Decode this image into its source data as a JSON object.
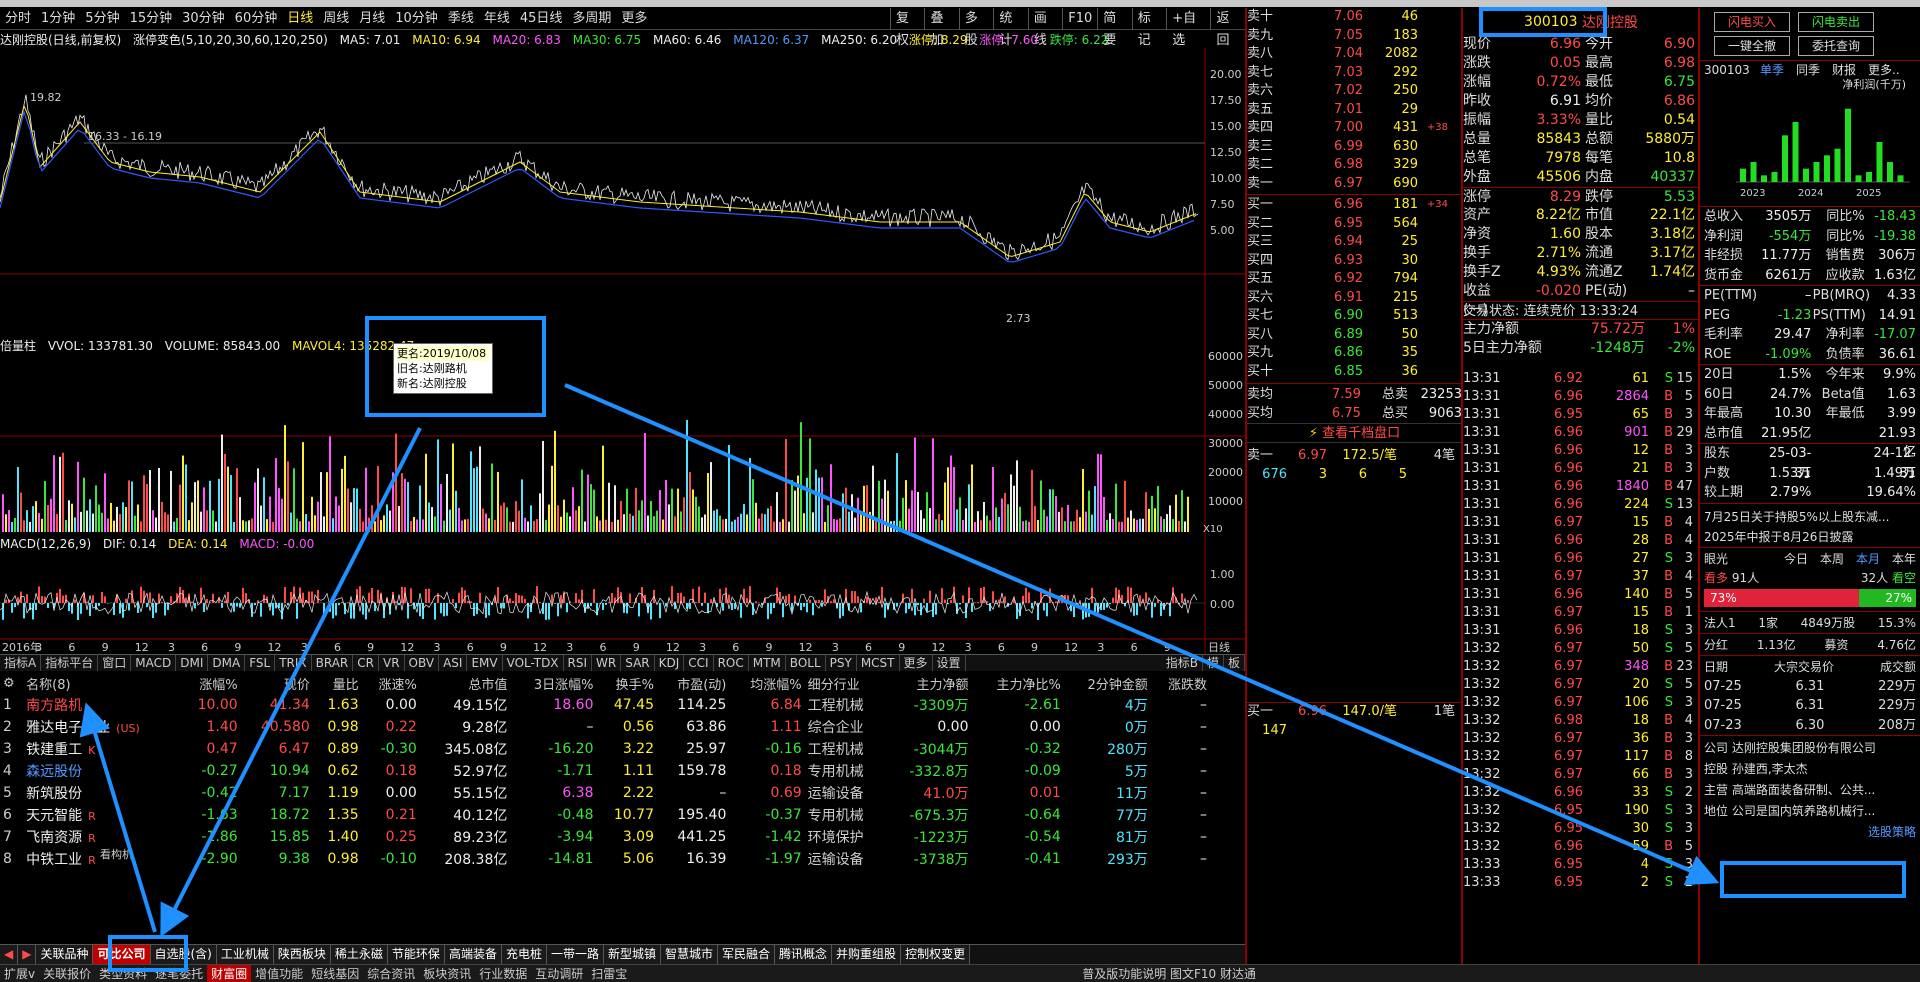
{
  "period_bar": {
    "items": [
      "分时",
      "1分钟",
      "5分钟",
      "15分钟",
      "30分钟",
      "60分钟",
      "日线",
      "周线",
      "月线",
      "10分钟",
      "季线",
      "年线",
      "45日线",
      "多周期",
      "更多"
    ],
    "active": "日线"
  },
  "toolbar": {
    "items": [
      "复权",
      "叠加",
      "多股",
      "统计",
      "画线",
      "F10",
      "简要",
      "标记",
      "+自选",
      "返回"
    ]
  },
  "chart_info": {
    "name": "达刚控股(日线,前复权)",
    "indicator": "涨停变色(5,10,20,30,60,120,250)",
    "ma5": "MA5: 7.01",
    "ma10": "MA10: 6.94",
    "ma20": "MA20: 6.83",
    "ma30": "MA30: 6.75",
    "ma60": "MA60: 6.46",
    "ma120": "MA120: 6.37",
    "ma250": "MA250: 6.20",
    "zt": "涨停: 8.29",
    "zd": "涨停: 7.60",
    "dt": "跌停: 6.22"
  },
  "price_axis": [
    "20.00",
    "17.50",
    "15.00",
    "12.50",
    "10.00",
    "7.50",
    "5.00"
  ],
  "price_marks": {
    "high": "19.82",
    "mid": "16.33 - 16.19",
    "low": "2.73"
  },
  "volume_info": {
    "name": "倍量柱",
    "vvol": "VVOL: 133781.30",
    "volume": "VOLUME: 85843.00",
    "mavol": "MAVOL4: 135282.47"
  },
  "volume_axis": [
    "60000",
    "50000",
    "40000",
    "30000",
    "20000",
    "10000"
  ],
  "volume_unit": "X10",
  "tooltip": {
    "line1": "更名:2019/10/08",
    "line2": "旧名:达刚路机",
    "line3": "新名:达刚控股"
  },
  "macd_info": {
    "name": "MACD(12,26,9)",
    "dif": "DIF: 0.14",
    "dea": "DEA: 0.14",
    "macd": "MACD: -0.00"
  },
  "macd_axis": [
    "1.00",
    "0.00"
  ],
  "time_axis": [
    "2016年",
    "3",
    "6",
    "9",
    "12",
    "3",
    "6",
    "9",
    "12",
    "3",
    "6",
    "9",
    "12",
    "3",
    "6",
    "9",
    "12",
    "3",
    "6",
    "9",
    "12",
    "3",
    "6",
    "9",
    "12",
    "3",
    "6",
    "9",
    "12",
    "3",
    "6",
    "9",
    "12",
    "3",
    "6",
    "9",
    "日线"
  ],
  "indicator_tabs": [
    "指标A",
    "指标平台",
    "窗口",
    "MACD",
    "DMI",
    "DMA",
    "FSL",
    "TRIX",
    "BRAR",
    "CR",
    "VR",
    "OBV",
    "ASI",
    "EMV",
    "VOL-TDX",
    "RSI",
    "WR",
    "SAR",
    "KDJ",
    "CCI",
    "ROC",
    "MTM",
    "BOLL",
    "PSY",
    "MCST",
    "更多",
    "设置"
  ],
  "indicator_right": [
    "指标B",
    "模",
    "板"
  ],
  "stock_table": {
    "headers": [
      "名称(8)",
      "涨幅%",
      "现价",
      "量比",
      "涨速%",
      "总市值",
      "3日涨幅%",
      "换手%",
      "市盈(动)",
      "均涨幅%",
      "细分行业",
      "主力净额",
      "主力净比%",
      "2分钟金额",
      "涨跌数"
    ],
    "rows": [
      [
        "1",
        "南方路机",
        "",
        "10.00",
        "41.34",
        "1.63",
        "0.00",
        "49.15亿",
        "18.60",
        "47.45",
        "114.25",
        "6.84",
        "工程机械",
        "-3309万",
        "-2.61",
        "4万",
        "–"
      ],
      [
        "2",
        "雅达电子工业",
        "(US)",
        "1.40",
        "40.580",
        "0.98",
        "0.22",
        "9.28亿",
        "–",
        "0.56",
        "63.86",
        "1.11",
        "综合企业",
        "0.00",
        "0.00",
        "0万",
        "–"
      ],
      [
        "3",
        "铁建重工",
        "K",
        "0.47",
        "6.47",
        "0.89",
        "-0.30",
        "345.08亿",
        "-16.20",
        "3.22",
        "25.97",
        "-0.16",
        "工程机械",
        "-3044万",
        "-0.32",
        "280万",
        "–"
      ],
      [
        "4",
        "森远股份",
        "",
        "-0.27",
        "10.94",
        "0.62",
        "0.18",
        "52.97亿",
        "-1.71",
        "1.11",
        "159.78",
        "0.18",
        "专用机械",
        "-332.8万",
        "-0.09",
        "5万",
        "–"
      ],
      [
        "5",
        "新筑股份",
        "",
        "-0.42",
        "7.17",
        "1.19",
        "0.00",
        "55.15亿",
        "6.38",
        "2.22",
        "–",
        "0.69",
        "运输设备",
        "41.0万",
        "0.01",
        "11万",
        "–"
      ],
      [
        "6",
        "天元智能",
        "R",
        "-1.63",
        "18.72",
        "1.35",
        "0.21",
        "40.12亿",
        "-0.48",
        "10.77",
        "195.40",
        "-0.37",
        "专用机械",
        "-675.3万",
        "-0.64",
        "77万",
        "–"
      ],
      [
        "7",
        "飞南资源",
        "R",
        "-1.86",
        "15.85",
        "1.40",
        "0.25",
        "89.23亿",
        "-3.94",
        "3.09",
        "441.25",
        "-1.42",
        "环境保护",
        "-1223万",
        "-0.54",
        "81万",
        "–"
      ],
      [
        "8",
        "中铁工业",
        "R",
        "-2.90",
        "9.38",
        "0.98",
        "-0.10",
        "208.38亿",
        "-14.81",
        "5.06",
        "16.39",
        "-1.97",
        "运输设备",
        "-3738万",
        "-0.41",
        "293万",
        "–"
      ]
    ],
    "row8_note": "看构机"
  },
  "sector_tabs": [
    "关联品种",
    "可比公司",
    "自选股(含)",
    "工业机械",
    "陕西板块",
    "稀土永磁",
    "节能环保",
    "高端装备",
    "充电桩",
    "一带一路",
    "新型城镇",
    "智慧城市",
    "军民融合",
    "腾讯概念",
    "并购重组股",
    "控制权变更"
  ],
  "sector_active": "可比公司",
  "bottom_bar": [
    "扩展v",
    "关联报价",
    "类型资料",
    "逐笔委托",
    "财富圈",
    "增值功能",
    "短线基因",
    "综合资讯",
    "板块资讯",
    "行业数据",
    "互动调研",
    "扫雷宝"
  ],
  "bottom_bar_right": "普及版功能说明 图文F10 财达通",
  "order_book": {
    "sells": [
      [
        "卖十",
        "7.06",
        "46",
        ""
      ],
      [
        "卖九",
        "7.05",
        "183",
        ""
      ],
      [
        "卖八",
        "7.04",
        "2082",
        ""
      ],
      [
        "卖七",
        "7.03",
        "292",
        ""
      ],
      [
        "卖六",
        "7.02",
        "250",
        ""
      ],
      [
        "卖五",
        "7.01",
        "29",
        ""
      ],
      [
        "卖四",
        "7.00",
        "431",
        "+38"
      ],
      [
        "卖三",
        "6.99",
        "630",
        ""
      ],
      [
        "卖二",
        "6.98",
        "329",
        ""
      ],
      [
        "卖一",
        "6.97",
        "690",
        ""
      ]
    ],
    "buys": [
      [
        "买一",
        "6.96",
        "181",
        "+34"
      ],
      [
        "买二",
        "6.95",
        "564",
        ""
      ],
      [
        "买三",
        "6.94",
        "25",
        ""
      ],
      [
        "买四",
        "6.93",
        "30",
        ""
      ],
      [
        "买五",
        "6.92",
        "794",
        ""
      ],
      [
        "买六",
        "6.91",
        "215",
        ""
      ],
      [
        "买七",
        "6.90",
        "513",
        ""
      ],
      [
        "买八",
        "6.89",
        "50",
        ""
      ],
      [
        "买九",
        "6.86",
        "35",
        ""
      ],
      [
        "买十",
        "6.85",
        "36",
        ""
      ]
    ],
    "avg_sell": [
      "卖均",
      "7.59",
      "总卖",
      "23253"
    ],
    "avg_buy": [
      "买均",
      "6.75",
      "总买",
      "9063"
    ],
    "view_more": "查看千档盘口",
    "sell1": [
      "卖一",
      "6.97",
      "172.5/笔",
      "4笔"
    ],
    "sell1_detail": [
      "676",
      "3",
      "6",
      "5"
    ],
    "buy1": [
      "买一",
      "6.96",
      "147.0/笔",
      "1笔"
    ],
    "buy1_detail": [
      "147"
    ]
  },
  "quote": {
    "code": "300103",
    "name": "达刚控股",
    "rows": [
      [
        "现价",
        "6.96",
        "今开",
        "6.90"
      ],
      [
        "涨跌",
        "0.05",
        "最高",
        "6.98"
      ],
      [
        "涨幅",
        "0.72%",
        "最低",
        "6.75"
      ],
      [
        "昨收",
        "6.91",
        "均价",
        "6.86"
      ],
      [
        "振幅",
        "3.33%",
        "量比",
        "0.54"
      ],
      [
        "总量",
        "85843",
        "总额",
        "5880万"
      ],
      [
        "总笔",
        "7978",
        "每笔",
        "10.8"
      ],
      [
        "外盘",
        "45506",
        "内盘",
        "40337"
      ],
      [
        "涨停",
        "8.29",
        "跌停",
        "5.53"
      ],
      [
        "资产",
        "8.22亿",
        "市值",
        "22.1亿"
      ],
      [
        "净资",
        "1.60",
        "股本",
        "3.18亿"
      ],
      [
        "换手",
        "2.71%",
        "流通",
        "3.17亿"
      ],
      [
        "换手Z",
        "4.93%",
        "流通Z",
        "1.74亿"
      ],
      [
        "收益(一)",
        "-0.020",
        "PE(动)",
        "–"
      ]
    ],
    "trade_status": "交易状态: 连续竞价 13:33:24",
    "main_flow": [
      "主力净额",
      "75.72万",
      "1%"
    ],
    "main_flow5": [
      "5日主力净额",
      "-1248万",
      "-2%"
    ]
  },
  "ticks": [
    [
      "13:31",
      "6.92",
      "61",
      "S",
      "15"
    ],
    [
      "13:31",
      "6.96",
      "2864",
      "B",
      "5"
    ],
    [
      "13:31",
      "6.95",
      "65",
      "B",
      "3"
    ],
    [
      "13:31",
      "6.96",
      "901",
      "B",
      "29"
    ],
    [
      "13:31",
      "6.96",
      "12",
      "B",
      "3"
    ],
    [
      "13:31",
      "6.96",
      "21",
      "B",
      "3"
    ],
    [
      "13:31",
      "6.96",
      "1840",
      "B",
      "47"
    ],
    [
      "13:31",
      "6.96",
      "224",
      "S",
      "13"
    ],
    [
      "13:31",
      "6.97",
      "15",
      "B",
      "4"
    ],
    [
      "13:31",
      "6.96",
      "28",
      "B",
      "4"
    ],
    [
      "13:31",
      "6.96",
      "27",
      "S",
      "3"
    ],
    [
      "13:31",
      "6.97",
      "37",
      "B",
      "4"
    ],
    [
      "13:31",
      "6.96",
      "140",
      "B",
      "5"
    ],
    [
      "13:31",
      "6.97",
      "15",
      "B",
      "1"
    ],
    [
      "13:31",
      "6.96",
      "18",
      "S",
      "3"
    ],
    [
      "13:32",
      "6.97",
      "50",
      "S",
      "5"
    ],
    [
      "13:32",
      "6.97",
      "348",
      "B",
      "23"
    ],
    [
      "13:32",
      "6.97",
      "20",
      "S",
      "5"
    ],
    [
      "13:32",
      "6.97",
      "106",
      "S",
      "3"
    ],
    [
      "13:32",
      "6.98",
      "18",
      "B",
      "4"
    ],
    [
      "13:32",
      "6.97",
      "36",
      "B",
      "3"
    ],
    [
      "13:32",
      "6.97",
      "117",
      "B",
      "8"
    ],
    [
      "13:32",
      "6.97",
      "66",
      "B",
      "3"
    ],
    [
      "13:32",
      "6.96",
      "33",
      "S",
      "2"
    ],
    [
      "13:32",
      "6.95",
      "190",
      "S",
      "3"
    ],
    [
      "13:32",
      "6.95",
      "30",
      "S",
      "3"
    ],
    [
      "13:32",
      "6.96",
      "59",
      "B",
      "5"
    ],
    [
      "13:33",
      "6.95",
      "4",
      "S",
      "3"
    ],
    [
      "13:33",
      "6.95",
      "2",
      "S",
      "2"
    ]
  ],
  "right_info": {
    "buttons": [
      "闪电买入",
      "闪电卖出",
      "一键全撤",
      "委托查询"
    ],
    "fin_tabs": [
      "单季",
      "同季",
      "财报",
      "更多.."
    ],
    "fin_code": "300103",
    "fin_label": "净利润(千万)",
    "fin_years": [
      "2023",
      "2024",
      "2025"
    ],
    "fin_values": [
      -2,
      -3,
      -1,
      -1.5,
      -7,
      -9,
      -2,
      -3,
      -4,
      -5,
      -11,
      -1,
      -1.5,
      -6,
      -3,
      -1
    ],
    "rows1": [
      [
        "总收入",
        "3505万",
        "同比%",
        "-18.43"
      ],
      [
        "净利润",
        "-554万",
        "同比%",
        "-19.38"
      ],
      [
        "非经损",
        "11.77万",
        "销售费",
        "306万"
      ],
      [
        "货币金",
        "6261万",
        "应收款",
        "1.63亿"
      ]
    ],
    "rows2": [
      [
        "PE(TTM)",
        "–",
        "PB(MRQ)",
        "4.33"
      ],
      [
        "PEG",
        "-1.23",
        "PS(TTM)",
        "14.91"
      ],
      [
        "毛利率",
        "29.47",
        "净利率",
        "-17.07"
      ],
      [
        "ROE",
        "-1.09%",
        "负债率",
        "36.61"
      ]
    ],
    "rows3": [
      [
        "20日",
        "1.5%",
        "今年来",
        "9.9%"
      ],
      [
        "60日",
        "24.7%",
        "Beta值",
        "1.63"
      ],
      [
        "年最高",
        "10.30",
        "年最低",
        "3.99"
      ],
      [
        "总市值",
        "21.95亿",
        "",
        "21.93亿"
      ]
    ],
    "rows4": [
      [
        "股东",
        "25-03-31",
        "",
        "24-12-31"
      ],
      [
        "户数",
        "1.53万",
        "",
        "1.49万"
      ],
      [
        "较上期",
        "2.79%",
        "",
        "19.64%"
      ]
    ],
    "news1": "7月25日关于持股5%以上股东减...",
    "news2": "2025年中报于8月26日披露",
    "eye": [
      "眼光",
      "今日",
      "本周",
      "本月",
      "本年"
    ],
    "sentiment": {
      "bull_label": "看多",
      "bull_count": "91人",
      "bear_count": "32人",
      "bear_label": "看空",
      "bull_pct": "73%",
      "bear_pct": "27%",
      "bull_share": 73
    },
    "inst": [
      "法人1",
      "1家",
      "4849万股",
      "15.3%"
    ],
    "dividend": [
      "分红",
      "1.13亿",
      "募资",
      "4.76亿"
    ],
    "block_headers": [
      "日期",
      "大宗交易价",
      "成交额"
    ],
    "blocks": [
      [
        "07-25",
        "6.31",
        "229万"
      ],
      [
        "07-25",
        "6.31",
        "229万"
      ],
      [
        "07-23",
        "6.30",
        "208万"
      ]
    ],
    "company": [
      "公司",
      "达刚控股集团股份有限公司"
    ],
    "holder": [
      "控股",
      "孙建西,李太杰"
    ],
    "business": [
      "主营",
      "高端路面装备研制、公共..."
    ],
    "position": [
      "地位",
      "公司是国内筑养路机械行..."
    ],
    "link": "选股策略"
  },
  "colors": {
    "up": "#ff4a4a",
    "down": "#3ae63a",
    "highlight": "#1e90ff",
    "active_tab": "#c00000"
  }
}
